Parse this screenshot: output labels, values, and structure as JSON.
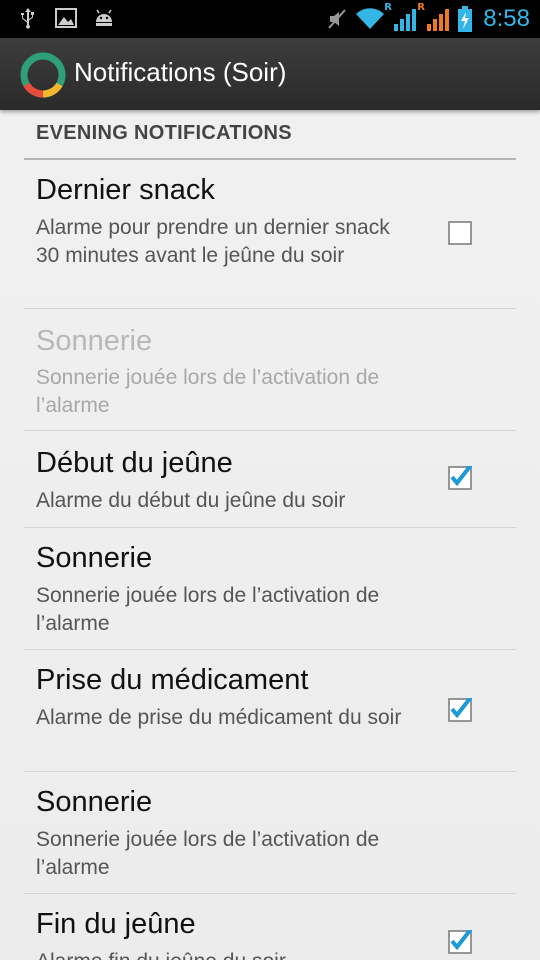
{
  "status_bar": {
    "time": "8:58",
    "icons": [
      "usb-icon",
      "picture-icon",
      "android-icon",
      "mute-icon",
      "wifi-icon",
      "signal-icon",
      "signal-icon",
      "battery-charging-icon"
    ],
    "roaming_label_1": "R",
    "roaming_label_2": "R",
    "accent": "#33b5e5"
  },
  "action_bar": {
    "title": "Notifications (Soir)",
    "logo_icon": "app-logo-icon"
  },
  "section": {
    "header": "EVENING NOTIFICATIONS"
  },
  "preferences": [
    {
      "title": "Dernier snack",
      "summary": "Alarme pour prendre un dernier snack 30 minutes avant le jeûne du soir",
      "checked": false,
      "enabled": true
    },
    {
      "title": "Sonnerie",
      "summary": "Sonnerie jouée lors de l’activation de l’alarme",
      "enabled": false
    },
    {
      "title": "Début du jeûne",
      "summary": "Alarme du début du jeûne du soir",
      "checked": true,
      "enabled": true
    },
    {
      "title": "Sonnerie",
      "summary": "Sonnerie jouée lors de l’activation de l’alarme",
      "enabled": true
    },
    {
      "title": "Prise du médicament",
      "summary": "Alarme de prise du médicament du soir",
      "checked": true,
      "enabled": true
    },
    {
      "title": "Sonnerie",
      "summary": "Sonnerie jouée lors de l’activation de l’alarme",
      "enabled": true
    },
    {
      "title": "Fin du jeûne",
      "summary": "Alarme fin du jeûne du soir",
      "checked": true,
      "enabled": true
    }
  ],
  "colors": {
    "check_blue": "#1a9ad8",
    "app_logo_ring": "#2f9e7a"
  }
}
